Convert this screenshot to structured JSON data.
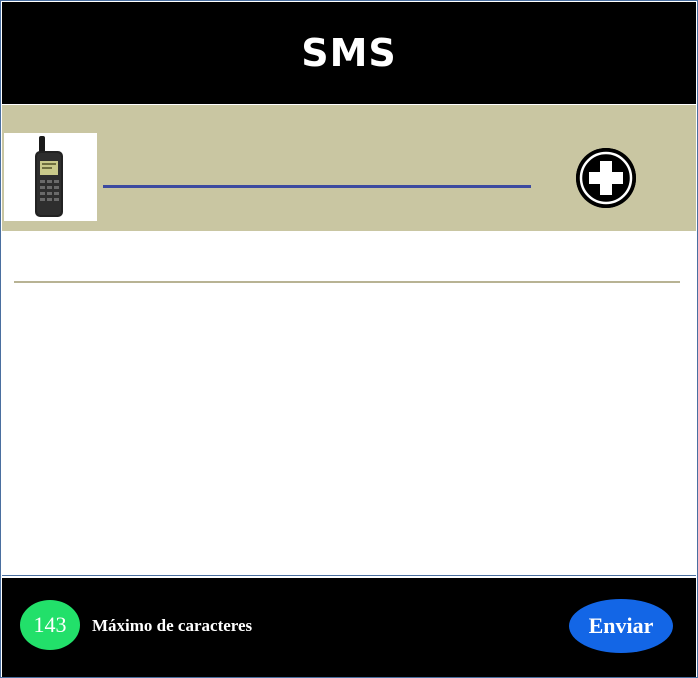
{
  "header": {
    "title": "SMS"
  },
  "recipient": {
    "phone_icon": "mobile-phone-icon",
    "add_icon": "plus-circle-icon",
    "value": ""
  },
  "message": {
    "value": ""
  },
  "footer": {
    "counter": "143",
    "counter_label": "Máximo de caracteres",
    "send_label": "Enviar"
  },
  "colors": {
    "header_bg": "#000000",
    "recipient_bar_bg": "#c9c6a2",
    "counter_badge": "#22e06a",
    "send_button": "#1366e6"
  }
}
